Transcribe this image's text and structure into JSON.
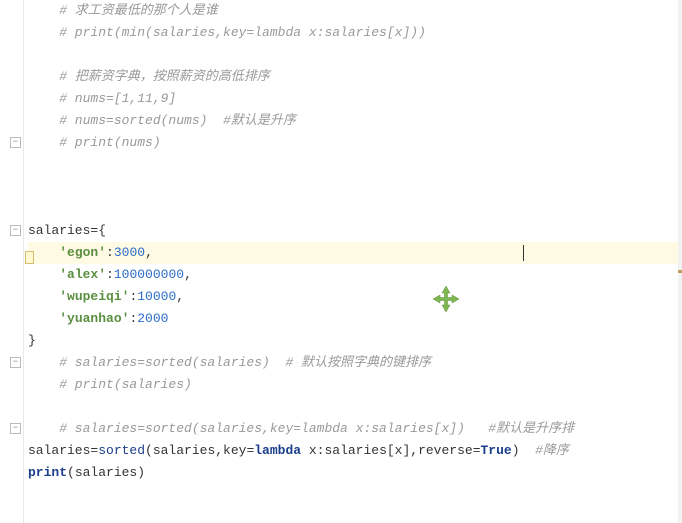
{
  "lines": [
    {
      "type": "comment",
      "text": "# 求工资最低的那个人是谁",
      "indent": 1
    },
    {
      "type": "comment",
      "text": "# print(min(salaries,key=lambda x:salaries[x]))",
      "indent": 1,
      "italic": true
    },
    {
      "type": "blank"
    },
    {
      "type": "comment",
      "text": "# 把薪资字典，按照薪资的高低排序",
      "indent": 1
    },
    {
      "type": "comment",
      "text": "# nums=[1,11,9]",
      "indent": 1,
      "italic": true
    },
    {
      "type": "comment",
      "text": "# nums=sorted(nums)  #默认是升序",
      "indent": 1,
      "italic": true
    },
    {
      "type": "comment",
      "text": "# print(nums)",
      "indent": 1,
      "italic": true,
      "fold": true
    },
    {
      "type": "blank"
    },
    {
      "type": "blank"
    },
    {
      "type": "blank"
    },
    {
      "type": "code_open",
      "ident": "salaries",
      "fold": true,
      "warn": true
    },
    {
      "type": "dict_entry",
      "key": "'egon'",
      "value": "3000",
      "comma": true,
      "highlighted": true,
      "cursor": 495
    },
    {
      "type": "dict_entry",
      "key": "'alex'",
      "value": "100000000",
      "comma": true
    },
    {
      "type": "dict_entry",
      "key": "'wupeiqi'",
      "value": "10000",
      "comma": true
    },
    {
      "type": "dict_entry",
      "key": "'yuanhao'",
      "value": "2000",
      "comma": false
    },
    {
      "type": "code_close"
    },
    {
      "type": "comment",
      "text": "# salaries=sorted(salaries)  # 默认按照字典的键排序",
      "indent": 1,
      "italic": true,
      "fold": true
    },
    {
      "type": "comment",
      "text": "# print(salaries)",
      "indent": 1,
      "italic": true
    },
    {
      "type": "blank"
    },
    {
      "type": "comment",
      "text": "# salaries=sorted(salaries,key=lambda x:salaries[x])   #默认是升序排",
      "indent": 1,
      "italic": true,
      "fold": true
    },
    {
      "type": "sorted_line"
    },
    {
      "type": "print_line"
    }
  ],
  "sorted_parts": {
    "lhs": "salaries",
    "func": "sorted",
    "arg1": "salaries",
    "key_kw": "key",
    "lambda_kw": "lambda",
    "lambda_body": " x:salaries[x]",
    "rev_kw": "reverse",
    "true_kw": "True",
    "tail_comment": "  #降序"
  },
  "print_parts": {
    "func": "print",
    "arg": "salaries"
  },
  "open_brace": "={",
  "close_brace": "}",
  "fold_glyph": "−"
}
